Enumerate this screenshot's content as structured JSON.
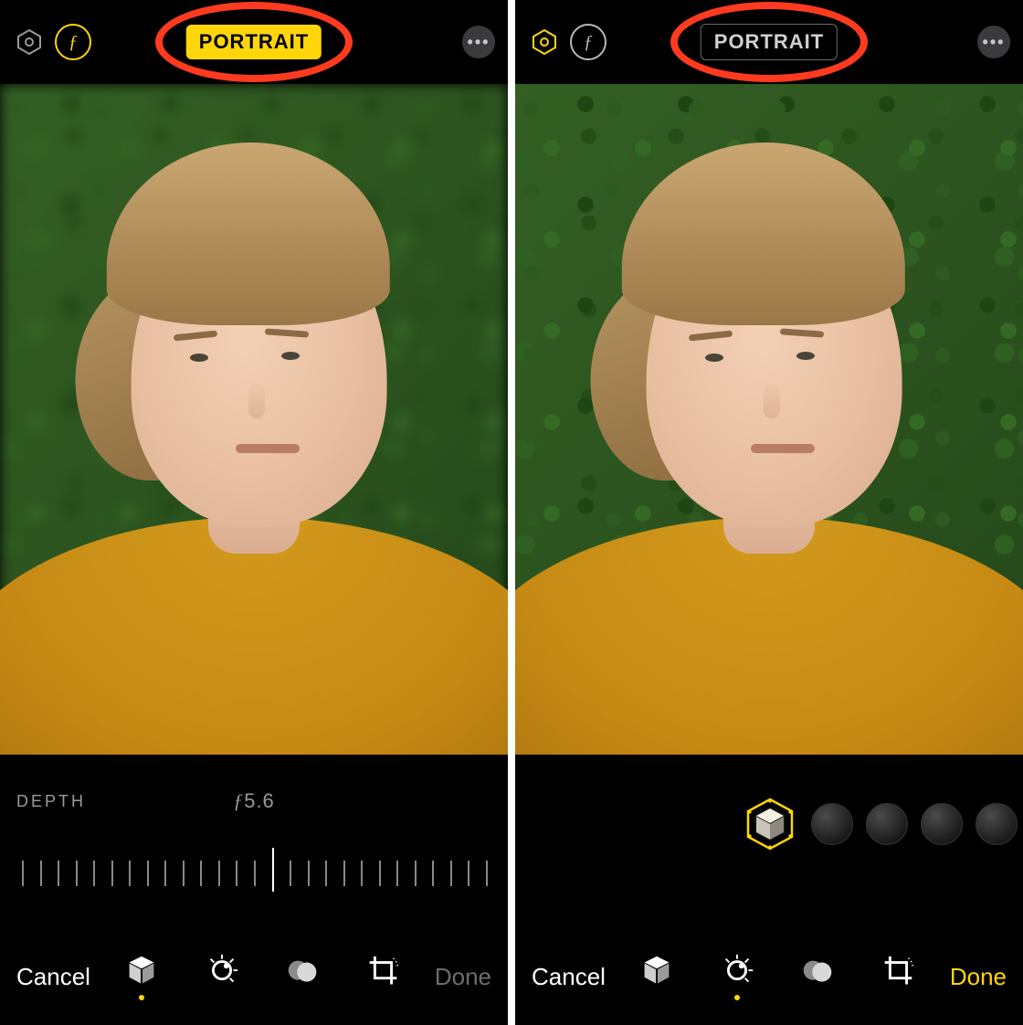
{
  "left": {
    "mode_label": "PORTRAIT",
    "mode_active": true,
    "f_active": true,
    "hex_active": false,
    "depth_label": "DEPTH",
    "depth_value_prefix": "ƒ",
    "depth_value_number": "5.6",
    "slider": {
      "ticks": 27,
      "major_every": 1,
      "marker_index": 14
    },
    "cancel_label": "Cancel",
    "done_label": "Done",
    "done_enabled": false,
    "active_tab_index": 0
  },
  "right": {
    "mode_label": "PORTRAIT",
    "mode_active": false,
    "f_active": false,
    "hex_active": true,
    "lighting_selected_index": 0,
    "lighting_count": 4,
    "cancel_label": "Cancel",
    "done_label": "Done",
    "done_enabled": true,
    "active_tab_index": 1
  },
  "tabs": [
    "portrait-cube",
    "adjust-dial",
    "filters-circles",
    "crop-rotate"
  ],
  "colors": {
    "accent": "#ffd60a",
    "annotation": "#ff3b1f"
  }
}
